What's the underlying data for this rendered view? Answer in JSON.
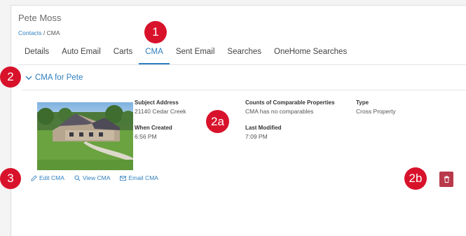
{
  "contact": {
    "name": "Pete Moss"
  },
  "breadcrumb": {
    "link": "Contacts",
    "separator": " / ",
    "current": "CMA"
  },
  "tabs": [
    {
      "label": "Details"
    },
    {
      "label": "Auto Email"
    },
    {
      "label": "Carts"
    },
    {
      "label": "CMA",
      "active": true
    },
    {
      "label": "Sent Email"
    },
    {
      "label": "Searches"
    },
    {
      "label": "OneHome Searches"
    }
  ],
  "section": {
    "title": "CMA for Pete",
    "icon": "chevron-down-icon"
  },
  "cma": {
    "subject_address_label": "Subject Address",
    "subject_address": "21140 Cedar Creek",
    "when_created_label": "When Created",
    "when_created": "6:56 PM",
    "counts_label": "Counts of Comparable Properties",
    "counts_value": "CMA has no comparables",
    "last_modified_label": "Last Modified",
    "last_modified": "7:09 PM",
    "type_label": "Type",
    "type_value": "Cross Property"
  },
  "actions": {
    "edit": "Edit CMA",
    "view": "View CMA",
    "email": "Email CMA"
  },
  "markers": {
    "m1": "1",
    "m2": "2",
    "m2a": "2a",
    "m2b": "2b",
    "m3": "3"
  },
  "colors": {
    "accent": "#2f7fbf",
    "marker": "#d8122b",
    "delete": "#b8394a"
  }
}
